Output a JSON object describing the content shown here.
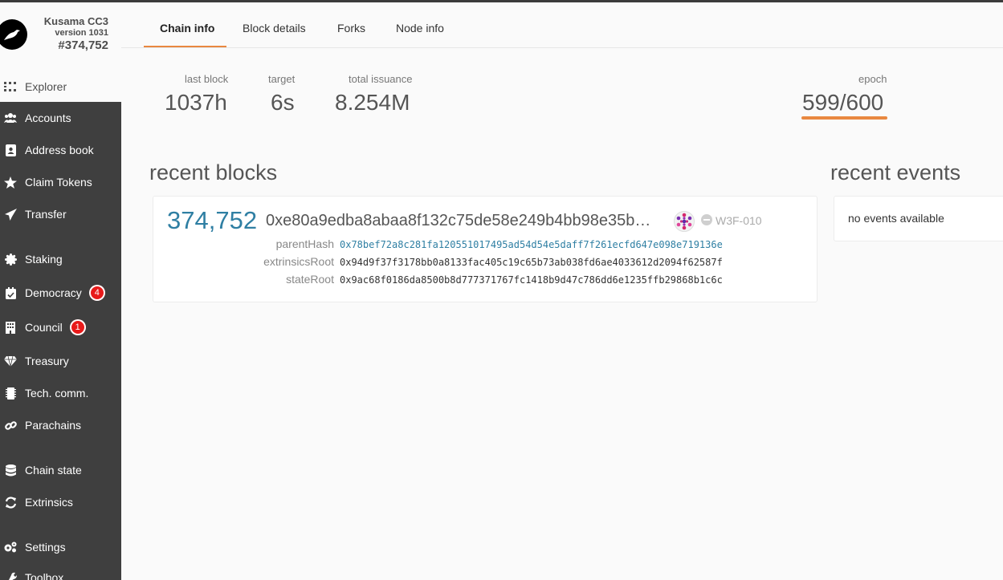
{
  "chain": {
    "name": "Kusama CC3",
    "version": "version 1031",
    "block": "#374,752"
  },
  "nav": [
    {
      "label": "Explorer",
      "icon": "grid-icon"
    },
    {
      "label": "Accounts",
      "icon": "users-icon"
    },
    {
      "label": "Address book",
      "icon": "address-book-icon"
    },
    {
      "label": "Claim Tokens",
      "icon": "star-icon"
    },
    {
      "label": "Transfer",
      "icon": "send-icon"
    },
    {
      "label": "Staking",
      "icon": "certificate-icon"
    },
    {
      "label": "Democracy",
      "icon": "calendar-check-icon",
      "badge": "4"
    },
    {
      "label": "Council",
      "icon": "building-icon",
      "badge": "1"
    },
    {
      "label": "Treasury",
      "icon": "gem-icon"
    },
    {
      "label": "Tech. comm.",
      "icon": "microchip-icon"
    },
    {
      "label": "Parachains",
      "icon": "link-icon"
    },
    {
      "label": "Chain state",
      "icon": "database-icon"
    },
    {
      "label": "Extrinsics",
      "icon": "sync-icon"
    },
    {
      "label": "Settings",
      "icon": "cogs-icon"
    },
    {
      "label": "Toolbox",
      "icon": "toolbox-icon"
    }
  ],
  "tabs": [
    "Chain info",
    "Block details",
    "Forks",
    "Node info"
  ],
  "summary": {
    "last_block_label": "last block",
    "last_block_value": "1037h",
    "target_label": "target",
    "target_value": "6s",
    "issuance_label": "total issuance",
    "issuance_value": "8.254M",
    "epoch_label": "epoch",
    "epoch_value": "599/600",
    "epoch_progress": 0.998
  },
  "recent_blocks": {
    "title": "recent blocks",
    "block": {
      "number": "374,752",
      "hash": "0xe80a9edba8abaa8f132c75de58e249b4bb98e35b…",
      "author": "W3F-010",
      "parentHash_label": "parentHash",
      "parentHash": "0x78bef72a8c281fa120551017495ad54d54e5daff7f261ecfd647e098e719136e",
      "extrinsicsRoot_label": "extrinsicsRoot",
      "extrinsicsRoot": "0x94d9f37f3178bb0a8133fac405c19c65b73ab038fd6ae4033612d2094f62587f",
      "stateRoot_label": "stateRoot",
      "stateRoot": "0x9ac68f0186da8500b8d777371767fc1418b9d47c786dd6e1235ffb29868b1c6c"
    }
  },
  "recent_events": {
    "title": "recent events",
    "empty": "no events available"
  },
  "colors": {
    "accent": "#e98840",
    "sidebar": "#3f3f3f",
    "link": "#2f7fa3",
    "badge": "#e81a1a"
  }
}
